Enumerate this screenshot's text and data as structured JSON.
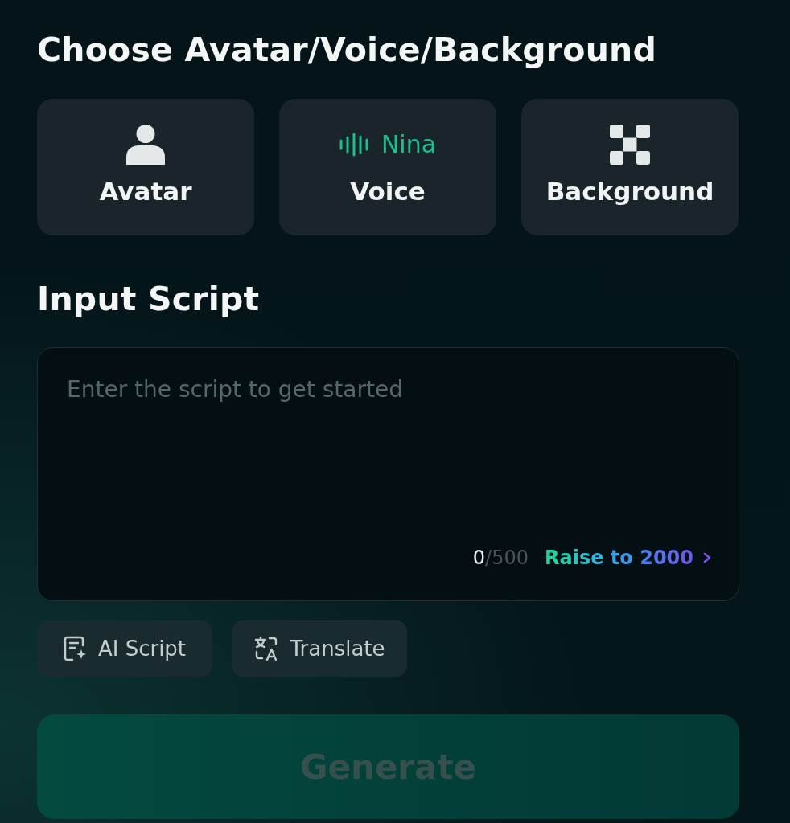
{
  "section_title": "Choose Avatar/Voice/Background",
  "options": [
    {
      "kind": "avatar",
      "label": "Avatar"
    },
    {
      "kind": "voice",
      "label": "Voice",
      "value": "Nina"
    },
    {
      "kind": "background",
      "label": "Background"
    }
  ],
  "script": {
    "title": "Input Script",
    "placeholder": "Enter the script to get started",
    "count": "0",
    "limit": "/500",
    "upgrade_link": "Raise to 2000"
  },
  "tools": [
    {
      "kind": "ai_script",
      "label": "AI Script"
    },
    {
      "kind": "translate",
      "label": "Translate"
    }
  ],
  "generate_button": {
    "label": "Generate",
    "disabled": true
  }
}
